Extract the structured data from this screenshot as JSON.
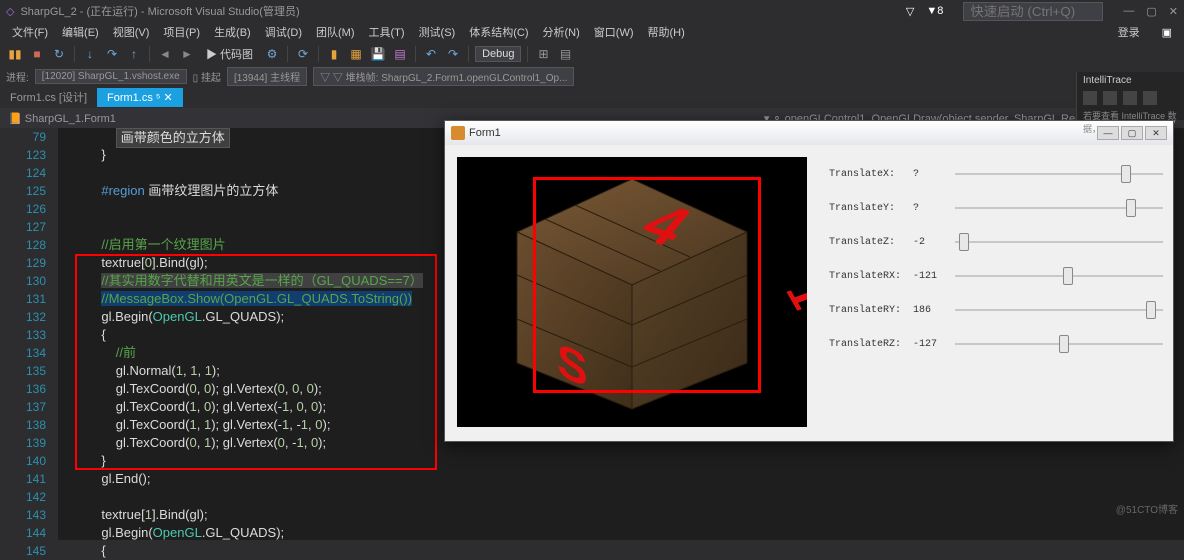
{
  "title_bar": {
    "title": "SharpGL_2 - (正在运行) - Microsoft Visual Studio(管理员)",
    "badge": "▼8",
    "quick_launch": "快速启动 (Ctrl+Q)",
    "login": "登录"
  },
  "menu": {
    "items": [
      "文件(F)",
      "编辑(E)",
      "视图(V)",
      "项目(P)",
      "生成(B)",
      "调试(D)",
      "团队(M)",
      "工具(T)",
      "测试(S)",
      "体系结构(C)",
      "分析(N)",
      "窗口(W)",
      "帮助(H)"
    ]
  },
  "toolbar": {
    "layout_label": "▶ 代码图",
    "debug_label": "Debug"
  },
  "process_bar": {
    "label": "进程:",
    "proc": "[12020] SharpGL_1.vshost.exe",
    "suspend": "▯ 挂起",
    "thread": "[13944] 主线程",
    "stack": "▽ ▽ 堆栈帧: SharpGL_2.Form1.openGLControl1_Op..."
  },
  "tabs": {
    "t1": "Form1.cs [设计]",
    "t2": "Form1.cs"
  },
  "crumb": {
    "left": "SharpGL_1.Form1",
    "right": "openGLControl1_OpenGLDraw(object sender, SharpGL.RenderEventArgs args)"
  },
  "lines": [
    {
      "n": "79",
      "t": "                画带颜色的立方体",
      "box": true
    },
    {
      "n": "123",
      "t": "            }"
    },
    {
      "n": "124",
      "t": ""
    },
    {
      "n": "125",
      "t": "            #region 画带纹理图片的立方体"
    },
    {
      "n": "126",
      "t": ""
    },
    {
      "n": "127",
      "t": ""
    },
    {
      "n": "128",
      "t": "            //启用第一个纹理图片"
    },
    {
      "n": "129",
      "t": "            textrue[0].Bind(gl);"
    },
    {
      "n": "130",
      "t": "            //其实用数字代替和用英文是一样的（GL_QUADS==7）",
      "hl": true
    },
    {
      "n": "131",
      "t": "            //MessageBox.Show(OpenGL.GL_QUADS.ToString())",
      "hl2": true
    },
    {
      "n": "132",
      "t": "            gl.Begin(OpenGL.GL_QUADS);"
    },
    {
      "n": "133",
      "t": "            {"
    },
    {
      "n": "134",
      "t": "                //前"
    },
    {
      "n": "135",
      "t": "                gl.Normal(1, 1, 1);"
    },
    {
      "n": "136",
      "t": "                gl.TexCoord(0, 0); gl.Vertex(0, 0, 0);"
    },
    {
      "n": "137",
      "t": "                gl.TexCoord(1, 0); gl.Vertex(-1, 0, 0);"
    },
    {
      "n": "138",
      "t": "                gl.TexCoord(1, 1); gl.Vertex(-1, -1, 0);"
    },
    {
      "n": "139",
      "t": "                gl.TexCoord(0, 1); gl.Vertex(0, -1, 0);"
    },
    {
      "n": "140",
      "t": "            }"
    },
    {
      "n": "141",
      "t": "            gl.End();"
    },
    {
      "n": "142",
      "t": ""
    },
    {
      "n": "143",
      "t": "            textrue[1].Bind(gl);"
    },
    {
      "n": "144",
      "t": "            gl.Begin(OpenGL.GL_QUADS);"
    },
    {
      "n": "145",
      "t": "            {"
    }
  ],
  "form": {
    "title": "Form1",
    "controls": [
      {
        "label": "TranslateX:",
        "value": "?",
        "pos": 80
      },
      {
        "label": "TranslateY:",
        "value": "?",
        "pos": 82
      },
      {
        "label": "TranslateZ:",
        "value": "-2",
        "pos": 2
      },
      {
        "label": "TranslateRX:",
        "value": "-121",
        "pos": 52
      },
      {
        "label": "TranslateRY:",
        "value": "186",
        "pos": 92
      },
      {
        "label": "TranslateRZ:",
        "value": "-127",
        "pos": 50
      }
    ]
  },
  "side": {
    "title": "IntelliTrace",
    "hint": "若要查看 IntelliTrace 数据，"
  },
  "watermark": "@51CTO博客"
}
